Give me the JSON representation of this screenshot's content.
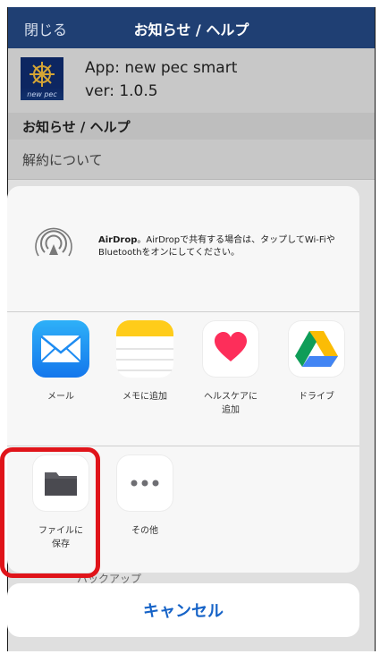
{
  "nav": {
    "close_label": "閉じる",
    "title": "お知らせ / ヘルプ"
  },
  "app_info": {
    "logo_text": "new pec",
    "name": "App: new pec smart",
    "version": "ver: 1.0.5"
  },
  "page": {
    "section_header": "お知らせ / ヘルプ",
    "items": [
      "解約について"
    ],
    "peek_text": "バックアップ"
  },
  "share_sheet": {
    "airdrop": {
      "icon": "airdrop-icon",
      "title": "AirDrop",
      "description": "。AirDropで共有する場合は、タップしてWi-FiやBluetoothをオンにしてください。"
    },
    "apps": [
      {
        "label": "メール",
        "icon": "mail-icon"
      },
      {
        "label": "メモに追加",
        "icon": "notes-icon"
      },
      {
        "label": "ヘルスケアに\n追加",
        "icon": "health-icon"
      },
      {
        "label": "ドライブ",
        "icon": "drive-icon"
      }
    ],
    "actions": [
      {
        "label": "ファイルに\n保存",
        "icon": "folder-icon"
      },
      {
        "label": "その他",
        "icon": "more-icon"
      }
    ],
    "cancel_label": "キャンセル"
  },
  "colors": {
    "nav_bar": "#1f3f73",
    "highlight": "#e0141a",
    "cancel_text": "#1663c7"
  }
}
